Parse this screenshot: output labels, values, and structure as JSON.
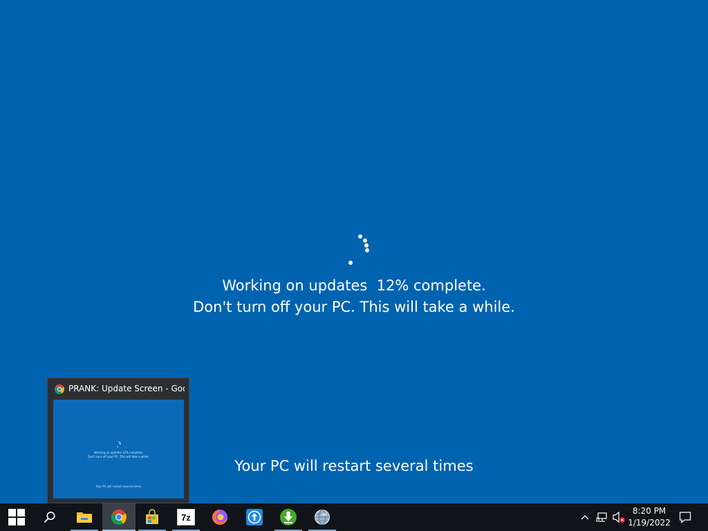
{
  "update": {
    "line1": "Working on updates  12% complete.",
    "line2": "Don't turn off your PC. This will take a while.",
    "progress_percent": 12,
    "restart_notice": "Your PC will restart several times"
  },
  "preview": {
    "title": "PRANK: Update Screen - Goo...",
    "icon": "chrome-icon",
    "thumb_line1": "Working on updates  12% complete.",
    "thumb_line2": "Don't turn off your PC. This will take a while.",
    "thumb_restart": "Your PC will restart several times"
  },
  "taskbar": {
    "items": [
      {
        "name": "start-button",
        "icon": "windows-logo-icon"
      },
      {
        "name": "search-button",
        "icon": "search-icon"
      },
      {
        "name": "file-explorer",
        "icon": "folder-icon"
      },
      {
        "name": "google-chrome",
        "icon": "chrome-icon",
        "active": true
      },
      {
        "name": "microsoft-store",
        "icon": "store-bag-icon"
      },
      {
        "name": "7zip",
        "icon": "7zip-icon",
        "label": "7z"
      },
      {
        "name": "firefox",
        "icon": "firefox-icon"
      },
      {
        "name": "upload-app",
        "icon": "upload-arrow-icon"
      },
      {
        "name": "download-app",
        "icon": "download-arrow-icon"
      },
      {
        "name": "network-app",
        "icon": "globe-icon"
      }
    ],
    "tray": {
      "time": "8:20 PM",
      "date": "1/19/2022"
    }
  },
  "colors": {
    "background": "#0063b0",
    "taskbar": "#101418",
    "accent": "#0078d7"
  }
}
